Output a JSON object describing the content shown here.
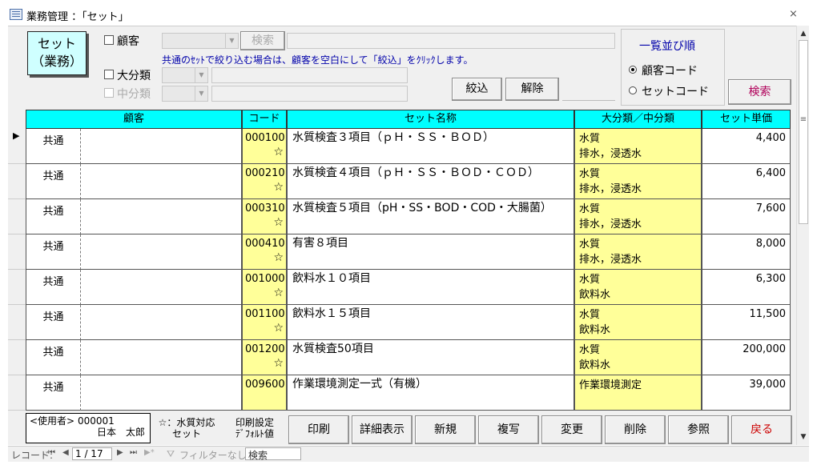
{
  "window": {
    "title": "業務管理 ：「セット」",
    "close_glyph": "⨯"
  },
  "logo": {
    "line1": "セット",
    "line2": "（業務）"
  },
  "filters": {
    "customer_label": "顧客",
    "search_button": "検索",
    "hint": "共通のｾｯﾄで絞り込む場合は、顧客を空白にして「絞込」をｸﾘｯｸします。",
    "major_label": "大分類",
    "middle_label": "中分類",
    "narrow_button": "絞込",
    "clear_button": "解除"
  },
  "sort": {
    "title": "一覧並び順",
    "option_customer": "顧客コード",
    "option_set": "セットコード",
    "selected": "customer"
  },
  "search_button": "検索",
  "columns": {
    "customer": "顧客",
    "code": "コード",
    "name": "セット名称",
    "category": "大分類／中分類",
    "price": "セット単価"
  },
  "current_row_marker": "▶",
  "star": "☆",
  "rows": [
    {
      "customer": "共通",
      "code": "000100",
      "star": true,
      "name": "水質検査３項目（ｐＨ・ＳＳ・ＢＯＤ）",
      "major": "水質",
      "middle": "排水，浸透水",
      "price": "4,400"
    },
    {
      "customer": "共通",
      "code": "000210",
      "star": true,
      "name": "水質検査４項目（ｐＨ・ＳＳ・ＢＯＤ・ＣＯＤ）",
      "major": "水質",
      "middle": "排水，浸透水",
      "price": "6,400"
    },
    {
      "customer": "共通",
      "code": "000310",
      "star": true,
      "name": "水質検査５項目（pH・SS・BOD・COD・大腸菌）",
      "major": "水質",
      "middle": "排水，浸透水",
      "price": "7,600"
    },
    {
      "customer": "共通",
      "code": "000410",
      "star": true,
      "name": "有害８項目",
      "major": "水質",
      "middle": "排水，浸透水",
      "price": "8,000"
    },
    {
      "customer": "共通",
      "code": "001000",
      "star": true,
      "name": "飲料水１０項目",
      "major": "水質",
      "middle": "飲料水",
      "price": "6,300"
    },
    {
      "customer": "共通",
      "code": "001100",
      "star": true,
      "name": "飲料水１５項目",
      "major": "水質",
      "middle": "飲料水",
      "price": "11,500"
    },
    {
      "customer": "共通",
      "code": "001200",
      "star": true,
      "name": "水質検査50項目",
      "major": "水質",
      "middle": "飲料水",
      "price": "200,000"
    },
    {
      "customer": "共通",
      "code": "009600",
      "star": false,
      "name": "作業環境測定一式（有機）",
      "major": "作業環境測定",
      "middle": "",
      "price": "39,000"
    }
  ],
  "footer": {
    "user_label": "<使用者>",
    "user_id": "000001",
    "user_name": "日本　太郎",
    "legend_line1": "☆：水質対応",
    "legend_line2": "セット",
    "print_setting_line1": "印刷設定",
    "print_setting_line2": "ﾃﾞﾌｫﾙﾄ値",
    "buttons": [
      "印刷",
      "詳細表示",
      "新規",
      "複写",
      "変更",
      "削除",
      "参照",
      "戻る"
    ]
  },
  "navigation": {
    "record_label": "レコード:",
    "position": "1 / 17",
    "filter_label": "フィルターなし",
    "search_label": "検索"
  }
}
